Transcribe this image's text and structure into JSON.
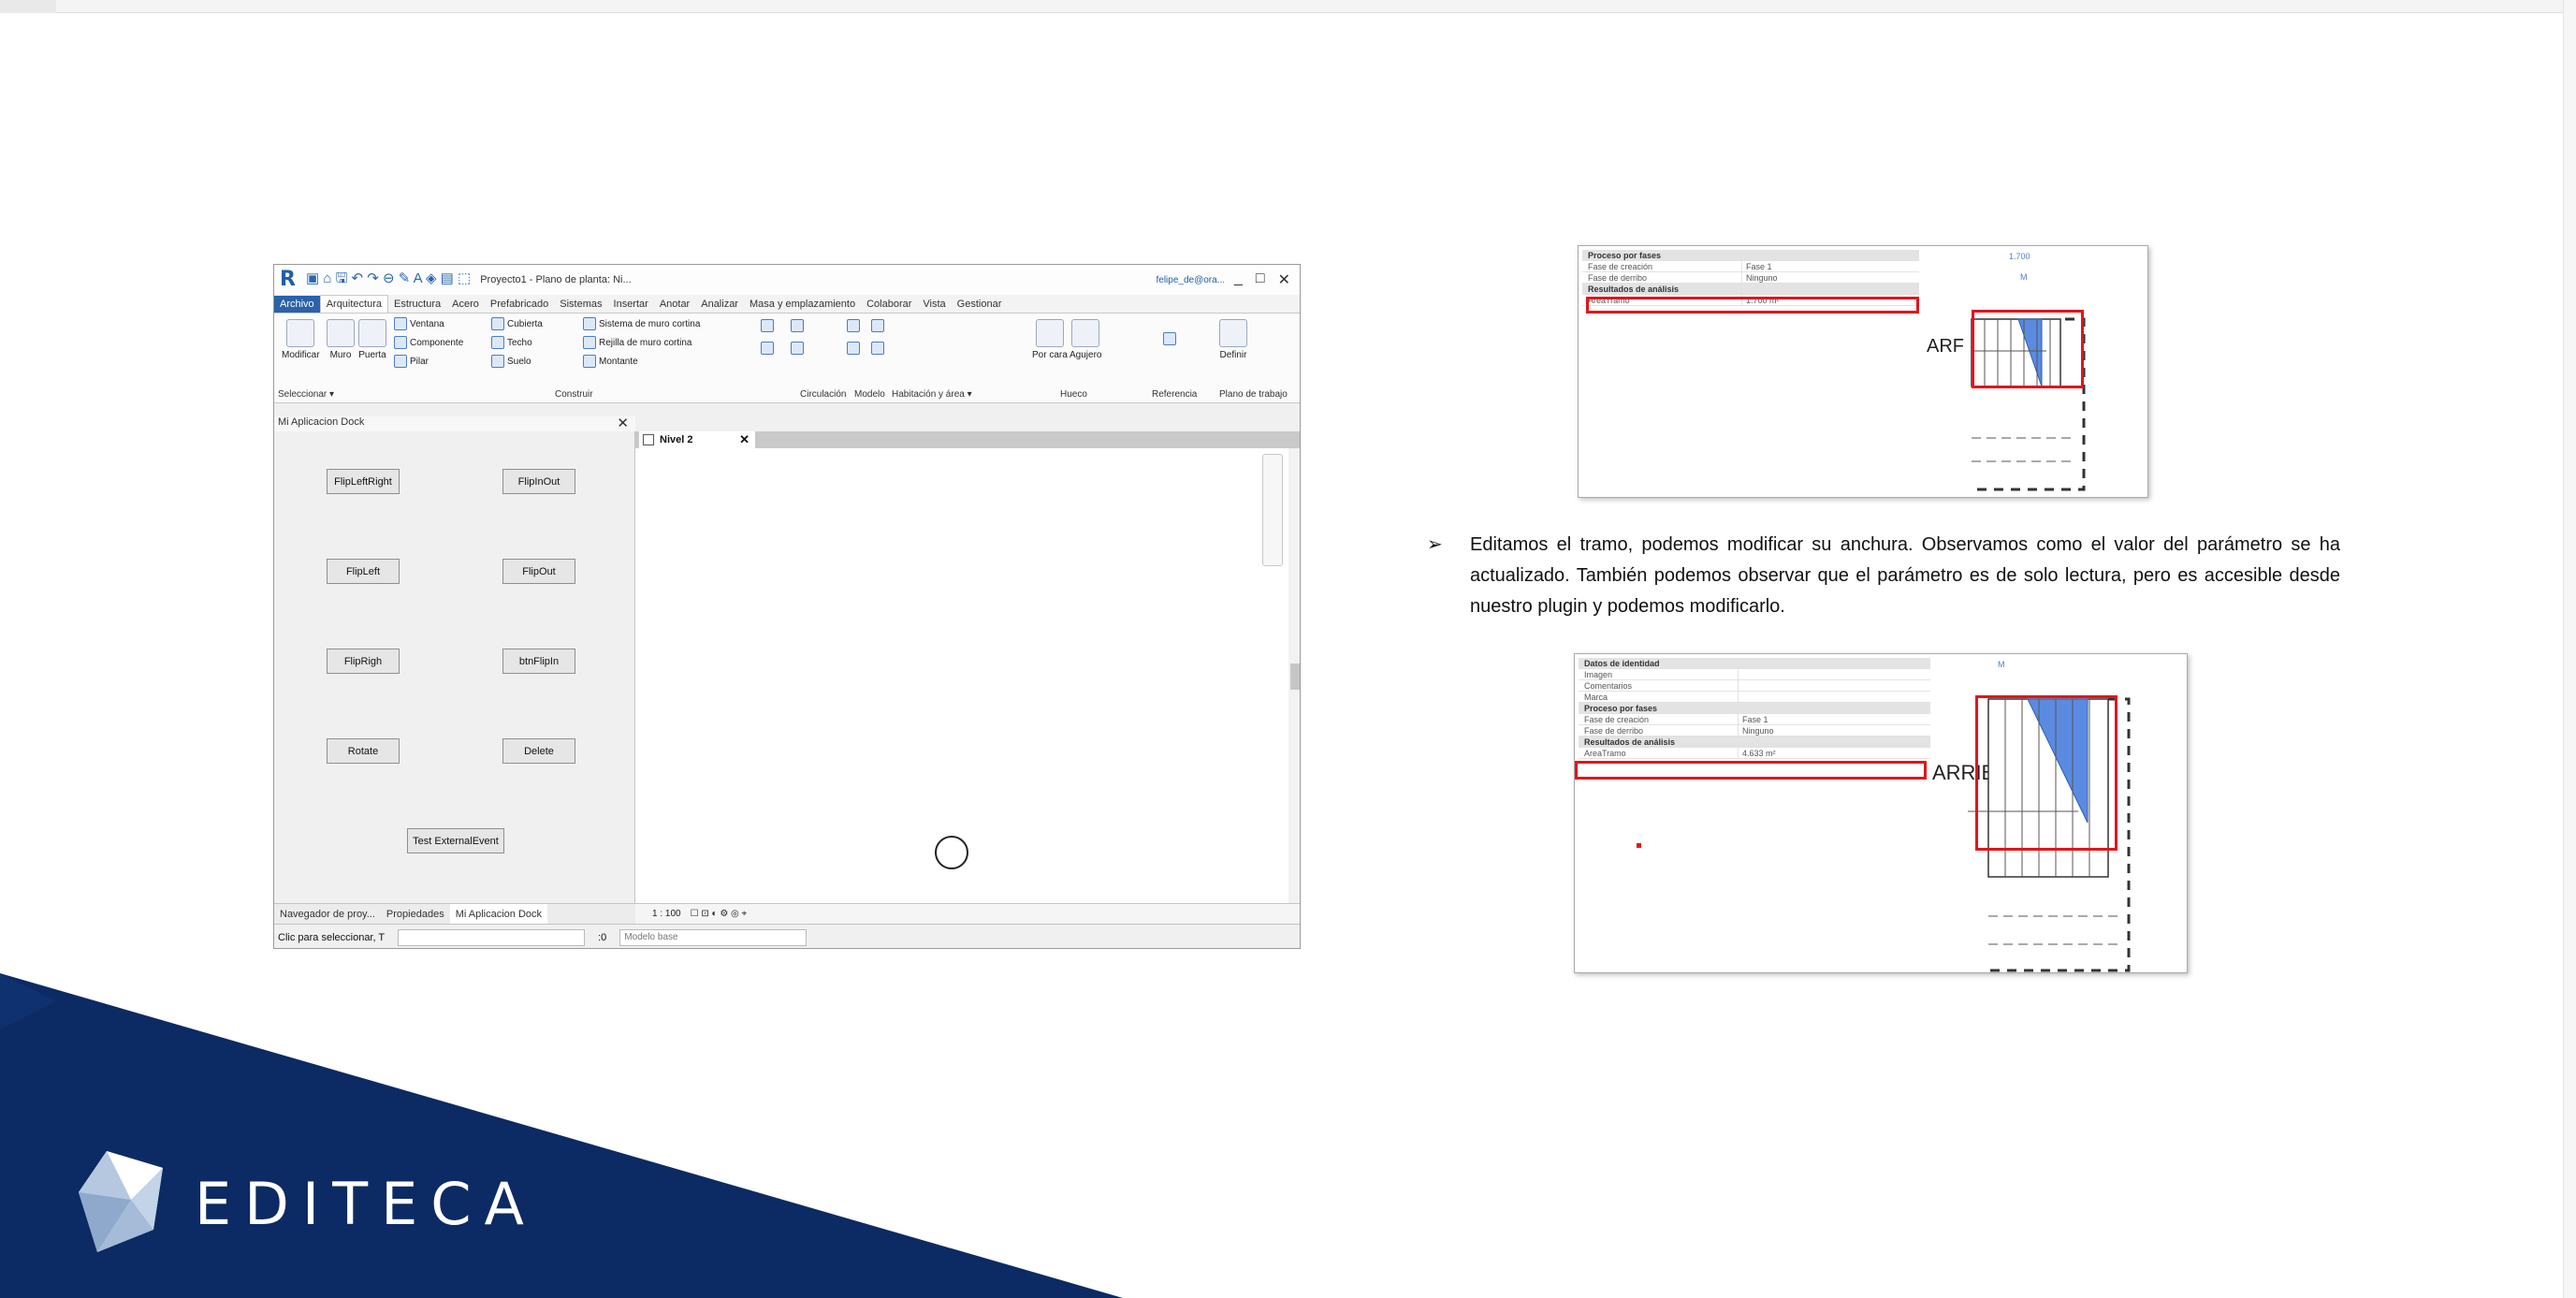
{
  "revit": {
    "title": "Proyecto1 - Plano de planta: Ni...",
    "user": "felipe_de@ora...",
    "tabs": [
      "Archivo",
      "Arquitectura",
      "Estructura",
      "Acero",
      "Prefabricado",
      "Sistemas",
      "Insertar",
      "Anotar",
      "Analizar",
      "Masa y emplazamiento",
      "Colaborar",
      "Vista",
      "Gestionar"
    ],
    "ribbon": {
      "modificar": "Modificar",
      "muro": "Muro",
      "puerta": "Puerta",
      "ventana": "Ventana",
      "componente": "Componente",
      "pilar": "Pilar",
      "cubierta": "Cubierta",
      "techo": "Techo",
      "suelo": "Suelo",
      "sistema_muro": "Sistema de muro cortina",
      "rejilla": "Rejilla de muro cortina",
      "montante": "Montante",
      "por_cara": "Por cara",
      "agujero": "Agujero",
      "definir": "Definir",
      "seleccionar": "Seleccionar ▾",
      "construir": "Construir",
      "circulacion": "Circulación",
      "modelo": "Modelo",
      "habitacion": "Habitación y área ▾",
      "hueco": "Hueco",
      "referencia": "Referencia",
      "plano_trabajo": "Plano de trabajo"
    },
    "dock_title": "Mi Aplicacion Dock",
    "buttons": [
      "FlipLeftRight",
      "FlipInOut",
      "FlipLeft",
      "FlipOut",
      "FlipRigh",
      "btnFlipIn",
      "Rotate",
      "Delete",
      "Test ExternalEvent"
    ],
    "view_tab": "Nivel 2",
    "bottom_tabs": [
      "Navegador de proy...",
      "Propiedades",
      "Mi Aplicacion Dock"
    ],
    "scale": "1 : 100",
    "status": "Clic para seleccionar, T",
    "status_zero": ":0",
    "modelo_base": "Modelo base"
  },
  "shot1": {
    "rows": [
      [
        "Proceso por fases",
        ""
      ],
      [
        "Fase de creación",
        "Fase 1"
      ],
      [
        "Fase de derribo",
        "Ninguno"
      ],
      [
        "Resultados de análisis",
        ""
      ],
      [
        "AreaTramo",
        "1.700 m²"
      ]
    ],
    "dim_top": "1.700",
    "dim_sub": "M",
    "label": "ARF"
  },
  "bullet": "Editamos el tramo, podemos modificar su anchura. Observamos como el valor del parámetro se ha actualizado. También podemos observar que el parámetro es de solo lectura, pero es accesible desde nuestro plugin y podemos modificarlo.",
  "shot2": {
    "rows": [
      [
        "Datos de identidad",
        ""
      ],
      [
        "Imagen",
        ""
      ],
      [
        "Comentarios",
        ""
      ],
      [
        "Marca",
        ""
      ],
      [
        "Proceso por fases",
        ""
      ],
      [
        "Fase de creación",
        "Fase 1"
      ],
      [
        "Fase de derribo",
        "Ninguno"
      ],
      [
        "Resultados de análisis",
        ""
      ],
      [
        "AreaTramo",
        "4.633 m²"
      ]
    ],
    "dim_top": "M",
    "label": "ARRIBA"
  },
  "brand": {
    "logo_text": "EDITECA",
    "banner_color": "#0c2a63"
  }
}
